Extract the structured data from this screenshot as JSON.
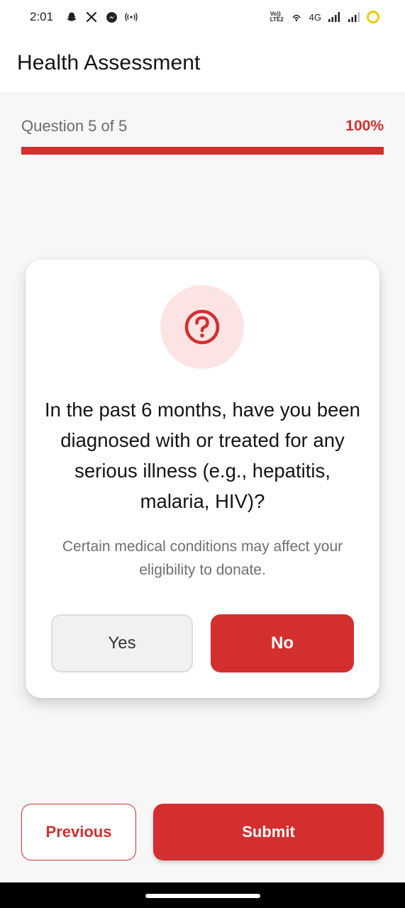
{
  "status_bar": {
    "time": "2:01",
    "left_icons": [
      "snapchat-icon",
      "x-icon",
      "messenger-icon",
      "hotspot-icon"
    ],
    "volte_top": "Vo))",
    "volte_bottom": "LTE2",
    "network": "4G",
    "right_icons": [
      "wifi-calling-icon",
      "signal-icon",
      "signal-icon",
      "battery-icon"
    ],
    "battery_color": "#f2c900"
  },
  "app_bar": {
    "title": "Health Assessment"
  },
  "progress": {
    "label": "Question 5 of 5",
    "percent_label": "100%",
    "value": 1.0
  },
  "question_card": {
    "icon": "question-circle-icon",
    "question": "In the past 6 months, have you been diagnosed with or treated for any serious illness (e.g., hepatitis, malaria, HIV)?",
    "hint": "Certain medical conditions may affect your eligibility to donate.",
    "yes_label": "Yes",
    "no_label": "No"
  },
  "actions": {
    "previous_label": "Previous",
    "submit_label": "Submit"
  },
  "colors": {
    "accent": "#d32f2f",
    "icon_bg": "#fce4e4",
    "page_bg": "#f7f7f7"
  }
}
